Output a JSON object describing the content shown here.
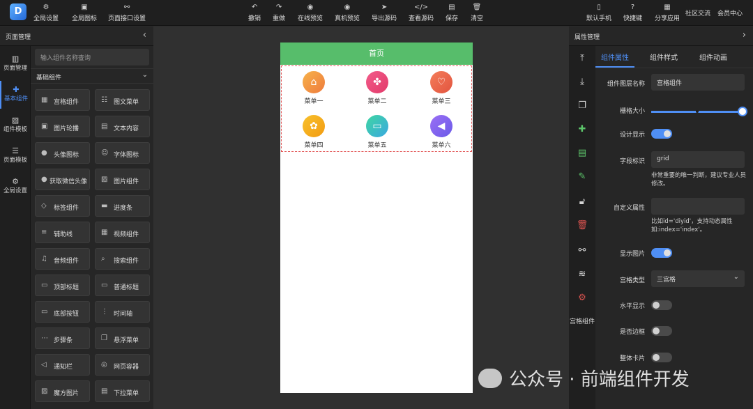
{
  "toolbar": {
    "left": [
      {
        "label": "全局设置",
        "icon": "gear-icon"
      },
      {
        "label": "全局图标",
        "icon": "image-icon"
      },
      {
        "label": "页面接口设置",
        "icon": "link-icon"
      }
    ],
    "center": [
      {
        "label": "撤销",
        "icon": "undo-icon"
      },
      {
        "label": "重做",
        "icon": "redo-icon"
      },
      {
        "label": "在线预览",
        "icon": "eye-icon"
      },
      {
        "label": "真机预览",
        "icon": "eye-icon"
      },
      {
        "label": "导出源码",
        "icon": "send-icon"
      },
      {
        "label": "查看源码",
        "icon": "code-icon"
      },
      {
        "label": "保存",
        "icon": "save-icon"
      },
      {
        "label": "清空",
        "icon": "trash-icon"
      }
    ],
    "right": [
      {
        "label": "默认手机",
        "icon": "phone-icon"
      },
      {
        "label": "快捷键",
        "icon": "help-icon"
      },
      {
        "label": "分享应用",
        "icon": "share-icon"
      }
    ],
    "links": [
      "社区交流",
      "会员中心"
    ]
  },
  "left_panel": {
    "title": "页面管理",
    "rail": [
      {
        "label": "页面管理",
        "icon": "layout-icon"
      },
      {
        "label": "基本组件",
        "icon": "puzzle-icon"
      },
      {
        "label": "组件模板",
        "icon": "template-icon"
      },
      {
        "label": "页面模板",
        "icon": "database-icon"
      },
      {
        "label": "全局设置",
        "icon": "gear-icon"
      }
    ],
    "search_placeholder": "输入组件名称查询",
    "group": "基础组件",
    "components": [
      {
        "label": "宫格组件",
        "icon": "grid-icon"
      },
      {
        "label": "图文菜单",
        "icon": "menu-icon"
      },
      {
        "label": "图片轮播",
        "icon": "carousel-icon"
      },
      {
        "label": "文本内容",
        "icon": "text-icon"
      },
      {
        "label": "头像图标",
        "icon": "avatar-icon"
      },
      {
        "label": "字体图标",
        "icon": "smile-icon"
      },
      {
        "label": "获取微信头像",
        "icon": "avatar-icon"
      },
      {
        "label": "图片组件",
        "icon": "image-icon"
      },
      {
        "label": "标签组件",
        "icon": "tag-icon"
      },
      {
        "label": "进度条",
        "icon": "progress-icon"
      },
      {
        "label": "辅助线",
        "icon": "lines-icon"
      },
      {
        "label": "视频组件",
        "icon": "video-icon"
      },
      {
        "label": "音频组件",
        "icon": "music-icon"
      },
      {
        "label": "搜索组件",
        "icon": "search-icon"
      },
      {
        "label": "顶部标题",
        "icon": "title-icon"
      },
      {
        "label": "普通标题",
        "icon": "title-icon"
      },
      {
        "label": "底部按钮",
        "icon": "footer-icon"
      },
      {
        "label": "时间轴",
        "icon": "timeline-icon"
      },
      {
        "label": "步骤条",
        "icon": "steps-icon"
      },
      {
        "label": "悬浮菜单",
        "icon": "float-icon"
      },
      {
        "label": "通知栏",
        "icon": "speaker-icon"
      },
      {
        "label": "网页容器",
        "icon": "globe-icon"
      },
      {
        "label": "魔方图片",
        "icon": "cube-icon"
      },
      {
        "label": "下拉菜单",
        "icon": "dropdown-icon"
      }
    ]
  },
  "phone": {
    "title": "首页",
    "menus": [
      {
        "label": "菜单一",
        "color": "#f5a24a",
        "icon": "home-icon"
      },
      {
        "label": "菜单二",
        "color": "#ee4f7b",
        "icon": "flower-icon"
      },
      {
        "label": "菜单三",
        "color": "#ee6a4e",
        "icon": "heart-icon"
      },
      {
        "label": "菜单四",
        "color": "#f6b21d",
        "icon": "settings-icon"
      },
      {
        "label": "菜单五",
        "color": "#2fc3a8",
        "icon": "chat-icon"
      },
      {
        "label": "菜单六",
        "color": "#8a62f0",
        "icon": "volume-icon"
      }
    ]
  },
  "right_panel": {
    "title": "属性管理",
    "tool_label": "宫格组件",
    "tabs": [
      "组件属性",
      "组件样式",
      "组件动画"
    ],
    "props": {
      "layer_name_label": "组件图层名称",
      "layer_name_value": "宫格组件",
      "size_label": "栅格大小",
      "size_value": 1.0,
      "design_show_label": "设计显示",
      "design_show_on": true,
      "field_label": "字段标识",
      "field_value": "grid",
      "field_hint": "非常重要的唯一判断，建议专业人员修改。",
      "custom_attr_label": "自定义属性",
      "custom_attr_value": "",
      "custom_attr_hint": "比如id='diyid'，支持动态属性如:index='index'。",
      "show_image_label": "显示图片",
      "show_image_on": true,
      "grid_type_label": "宫格类型",
      "grid_type_value": "三宫格",
      "horizontal_label": "水平显示",
      "horizontal_on": false,
      "border_label": "是否边框",
      "border_on": false,
      "card_label": "整体卡片",
      "card_on": false
    }
  },
  "watermark": "公众号 · 前端组件开发"
}
